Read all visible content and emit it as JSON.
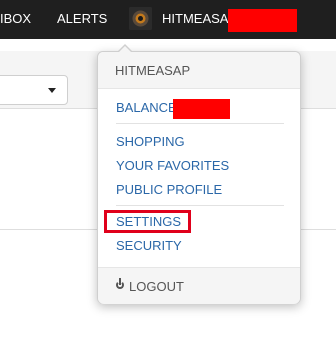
{
  "topbar": {
    "inbox_label": "IBOX",
    "alerts_label": "ALERTS",
    "user_name": "HITMEASAP"
  },
  "menu": {
    "header": "HITMEASAP",
    "balance_label": "BALANCE",
    "shopping_label": "SHOPPING",
    "favorites_label": "YOUR FAVORITES",
    "profile_label": "PUBLIC PROFILE",
    "settings_label": "SETTINGS",
    "security_label": "SECURITY",
    "logout_label": "LOGOUT"
  },
  "icons": [
    "avatar-image",
    "caret-down-icon",
    "power-icon"
  ],
  "colors": {
    "topbar_bg": "#1f1f1f",
    "link": "#2a67a8",
    "redaction": "#ff0000",
    "highlight": "#e0001b"
  }
}
